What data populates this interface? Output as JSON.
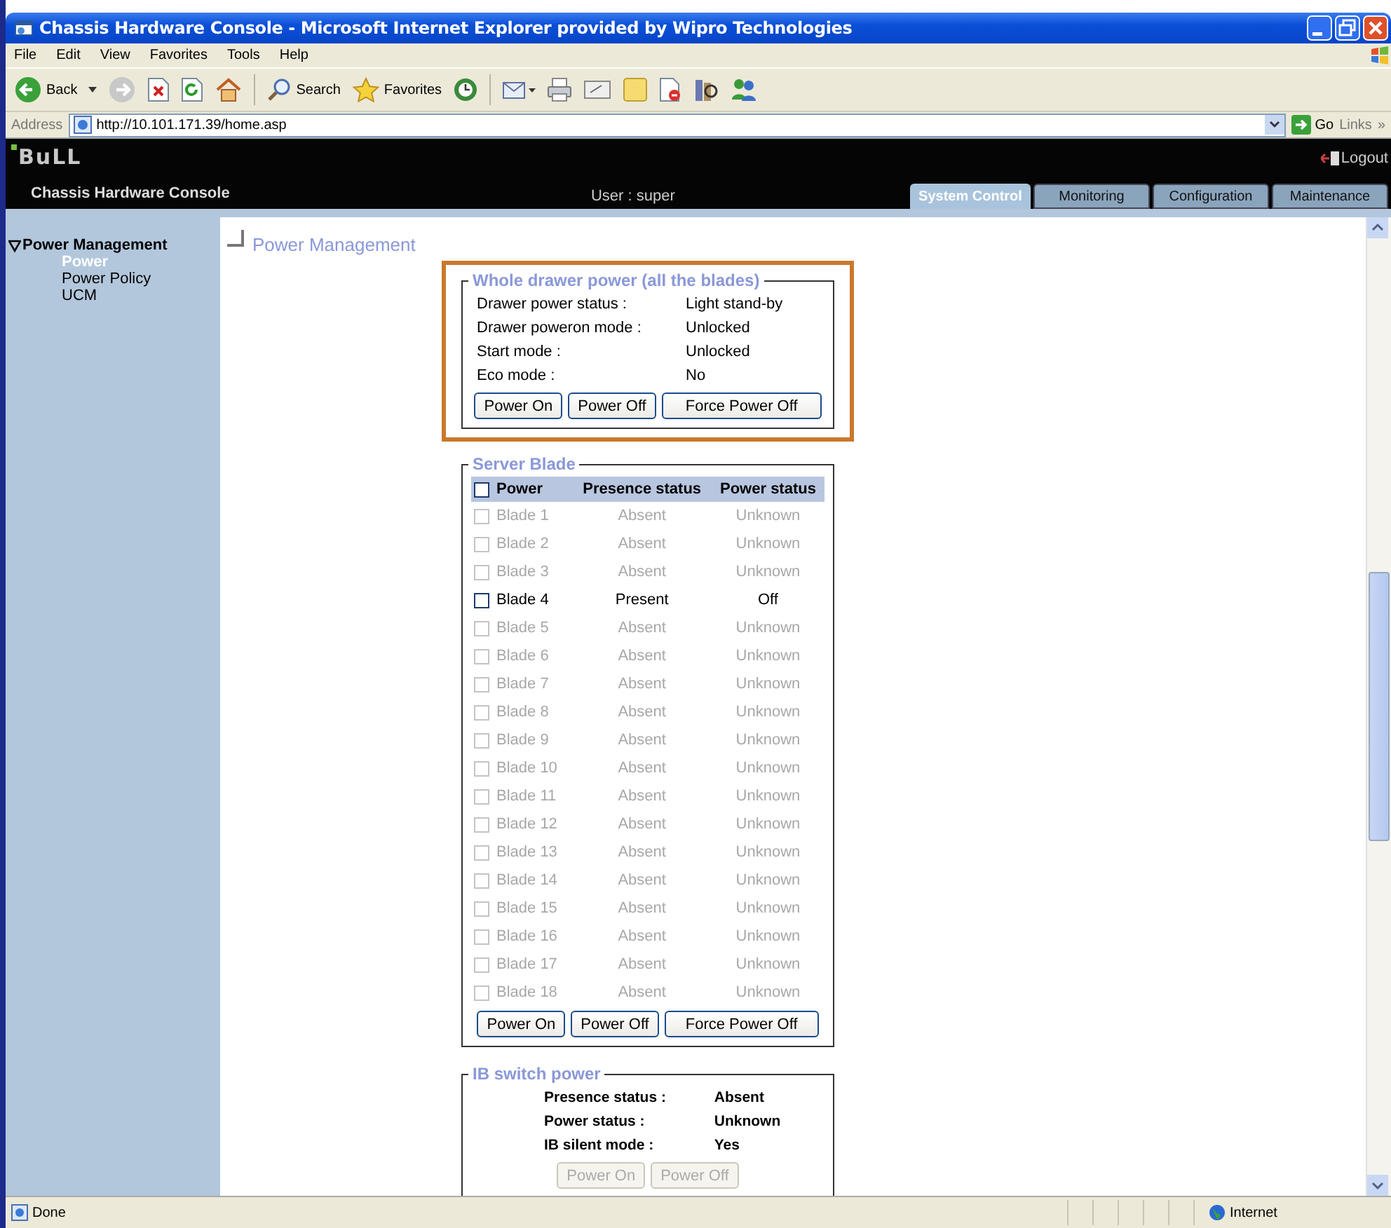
{
  "window": {
    "title": "Chassis Hardware Console - Microsoft Internet Explorer provided by Wipro Technologies"
  },
  "menu": [
    "File",
    "Edit",
    "View",
    "Favorites",
    "Tools",
    "Help"
  ],
  "toolbar": {
    "back": "Back",
    "search": "Search",
    "favorites": "Favorites"
  },
  "address": {
    "label": "Address",
    "url": "http://10.101.171.39/home.asp",
    "go": "Go",
    "links": "Links",
    "more": "»"
  },
  "header": {
    "logo": "BuLL",
    "app_name": "Chassis Hardware Console",
    "user": "User : super",
    "logout": "Logout"
  },
  "tabs": [
    {
      "label": "System Control",
      "selected": true
    },
    {
      "label": "Monitoring",
      "selected": false
    },
    {
      "label": "Configuration",
      "selected": false
    },
    {
      "label": "Maintenance",
      "selected": false
    }
  ],
  "sidebar": {
    "group": {
      "label": "Power Management",
      "expanded": true
    },
    "items": [
      {
        "label": "Power",
        "selected": true
      },
      {
        "label": "Power Policy",
        "selected": false
      },
      {
        "label": "UCM",
        "selected": false
      }
    ]
  },
  "page_title": "Power Management",
  "drawer": {
    "legend": "Whole drawer power (all the blades)",
    "highlighted": true,
    "fields": [
      {
        "label": "Drawer power status :",
        "value": "Light stand-by"
      },
      {
        "label": "Drawer poweron mode :",
        "value": "Unlocked"
      },
      {
        "label": "Start mode :",
        "value": "Unlocked"
      },
      {
        "label": "Eco mode :",
        "value": "No"
      }
    ],
    "buttons": [
      {
        "label": "Power On",
        "disabled": false
      },
      {
        "label": "Power Off",
        "disabled": false
      },
      {
        "label": "Force Power Off",
        "disabled": false
      }
    ]
  },
  "server_blade": {
    "legend": "Server Blade",
    "columns": [
      "Power",
      "Presence status",
      "Power status"
    ],
    "select_all_checked": false,
    "rows": [
      {
        "name": "Blade 1",
        "presence": "Absent",
        "power": "Unknown",
        "disabled": true,
        "checked": false
      },
      {
        "name": "Blade 2",
        "presence": "Absent",
        "power": "Unknown",
        "disabled": true,
        "checked": false
      },
      {
        "name": "Blade 3",
        "presence": "Absent",
        "power": "Unknown",
        "disabled": true,
        "checked": false
      },
      {
        "name": "Blade 4",
        "presence": "Present",
        "power": "Off",
        "disabled": false,
        "checked": false
      },
      {
        "name": "Blade 5",
        "presence": "Absent",
        "power": "Unknown",
        "disabled": true,
        "checked": false
      },
      {
        "name": "Blade 6",
        "presence": "Absent",
        "power": "Unknown",
        "disabled": true,
        "checked": false
      },
      {
        "name": "Blade 7",
        "presence": "Absent",
        "power": "Unknown",
        "disabled": true,
        "checked": false
      },
      {
        "name": "Blade 8",
        "presence": "Absent",
        "power": "Unknown",
        "disabled": true,
        "checked": false
      },
      {
        "name": "Blade 9",
        "presence": "Absent",
        "power": "Unknown",
        "disabled": true,
        "checked": false
      },
      {
        "name": "Blade 10",
        "presence": "Absent",
        "power": "Unknown",
        "disabled": true,
        "checked": false
      },
      {
        "name": "Blade 11",
        "presence": "Absent",
        "power": "Unknown",
        "disabled": true,
        "checked": false
      },
      {
        "name": "Blade 12",
        "presence": "Absent",
        "power": "Unknown",
        "disabled": true,
        "checked": false
      },
      {
        "name": "Blade 13",
        "presence": "Absent",
        "power": "Unknown",
        "disabled": true,
        "checked": false
      },
      {
        "name": "Blade 14",
        "presence": "Absent",
        "power": "Unknown",
        "disabled": true,
        "checked": false
      },
      {
        "name": "Blade 15",
        "presence": "Absent",
        "power": "Unknown",
        "disabled": true,
        "checked": false
      },
      {
        "name": "Blade 16",
        "presence": "Absent",
        "power": "Unknown",
        "disabled": true,
        "checked": false
      },
      {
        "name": "Blade 17",
        "presence": "Absent",
        "power": "Unknown",
        "disabled": true,
        "checked": false
      },
      {
        "name": "Blade 18",
        "presence": "Absent",
        "power": "Unknown",
        "disabled": true,
        "checked": false
      }
    ],
    "buttons": [
      {
        "label": "Power On",
        "disabled": false
      },
      {
        "label": "Power Off",
        "disabled": false
      },
      {
        "label": "Force Power Off",
        "disabled": false
      }
    ]
  },
  "ib_switch": {
    "legend": "IB switch power",
    "fields": [
      {
        "label": "Presence status :",
        "value": "Absent"
      },
      {
        "label": "Power status :",
        "value": "Unknown"
      },
      {
        "label": "IB silent mode :",
        "value": "Yes"
      }
    ],
    "buttons": [
      {
        "label": "Power On",
        "disabled": true
      },
      {
        "label": "Power Off",
        "disabled": true
      }
    ]
  },
  "status_bar": {
    "status": "Done",
    "zone": "Internet"
  }
}
